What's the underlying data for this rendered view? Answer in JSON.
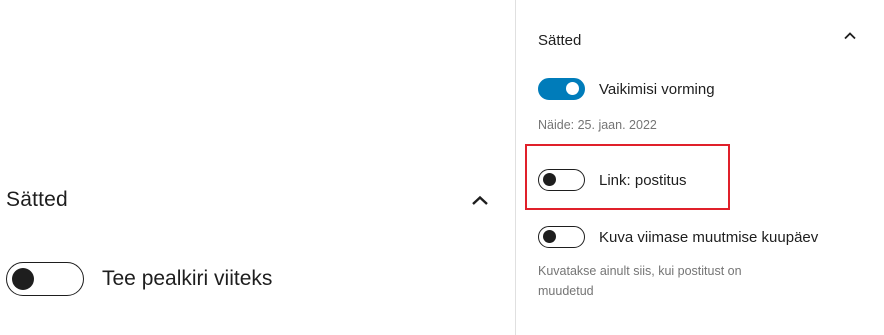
{
  "left": {
    "title": "Sätted",
    "toggle_label": "Tee pealkiri viiteks",
    "toggle_on": false
  },
  "right": {
    "title": "Sätted",
    "default_format": {
      "label": "Vaikimisi vorming",
      "on": true,
      "help": "Näide: 25. jaan. 2022"
    },
    "link_to_post": {
      "label": "Link: postitus",
      "on": false
    },
    "show_modified": {
      "label": "Kuva viimase muutmise kuupäev",
      "on": false,
      "help_line1": "Kuvatakse ainult siis, kui postitust on",
      "help_line2": "muudetud"
    }
  },
  "colors": {
    "accent": "#007cba",
    "highlight": "#e0202a",
    "text": "#1e1e1e",
    "muted": "#757575"
  },
  "icons": {
    "collapse": "chevron-up-icon"
  }
}
